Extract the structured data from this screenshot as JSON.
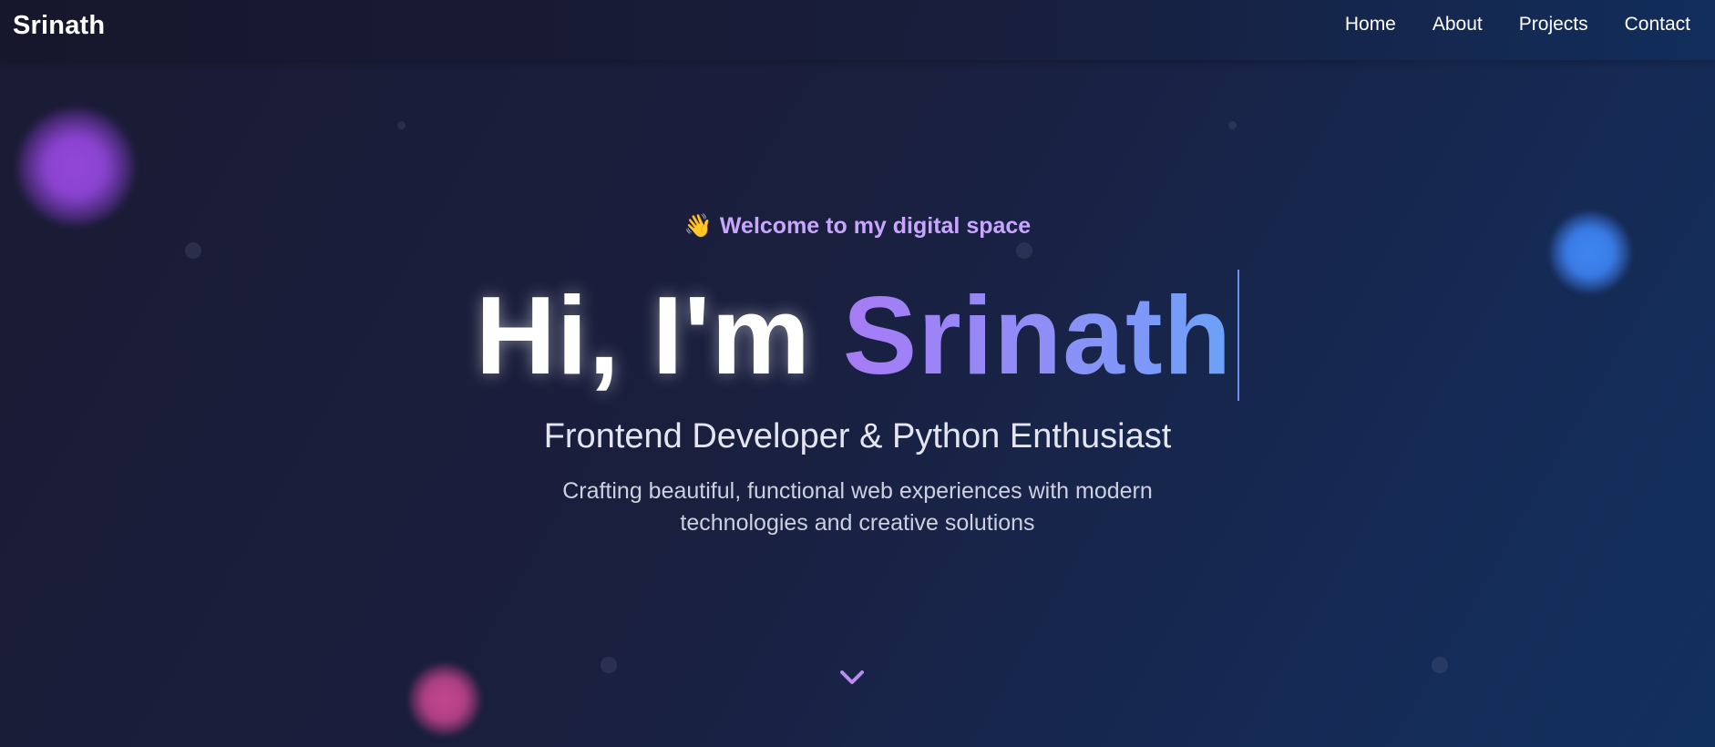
{
  "nav": {
    "brand": "Srinath",
    "links": [
      "Home",
      "About",
      "Projects",
      "Contact"
    ]
  },
  "hero": {
    "welcome_icon": "👋",
    "welcome_text": "Welcome to my digital space",
    "greeting": "Hi, I'm ",
    "name": "Srinath",
    "subtitle": "Frontend Developer & Python Enthusiast",
    "description": "Crafting beautiful, functional web experiences with modern technologies and creative solutions"
  },
  "colors": {
    "accent_purple": "#c8a6ff",
    "gradient_start": "#a77bf5",
    "gradient_end": "#6ca1f8",
    "scroll_arrow": "#b98cf0"
  },
  "icons": {
    "scroll": "chevron-down-icon",
    "welcome": "waving-hand-icon"
  }
}
